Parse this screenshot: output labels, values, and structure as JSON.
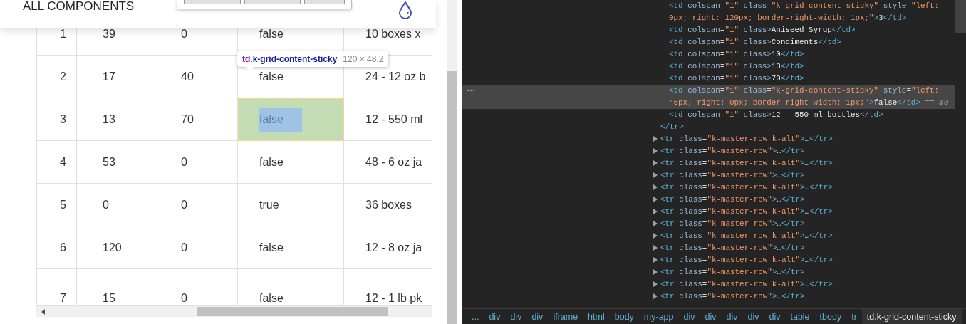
{
  "app_header": {
    "title": "ALL COMPONENTS"
  },
  "grid": {
    "rows": [
      {
        "cells": [
          "1",
          "39",
          "0",
          "false",
          "10 boxes x"
        ],
        "inspected": false
      },
      {
        "cells": [
          "2",
          "17",
          "40",
          "false",
          "24 - 12 oz b"
        ],
        "inspected": false
      },
      {
        "cells": [
          "3",
          "13",
          "70",
          "false",
          "12 - 550 ml"
        ],
        "inspected": true
      },
      {
        "cells": [
          "4",
          "53",
          "0",
          "false",
          "48 - 6 oz ja"
        ],
        "inspected": false
      },
      {
        "cells": [
          "5",
          "0",
          "0",
          "true",
          "36 boxes"
        ],
        "inspected": false
      },
      {
        "cells": [
          "6",
          "120",
          "0",
          "false",
          "12 - 8 oz ja"
        ],
        "inspected": false
      },
      {
        "cells": [
          "7",
          "15",
          "0",
          "false",
          "12 - 1 lb pk"
        ],
        "inspected": false
      }
    ]
  },
  "inspect_tooltip": {
    "tag": "td",
    "selector": ".k-grid-content-sticky",
    "size": "120 × 48.2"
  },
  "devtools": {
    "lines": [
      {
        "kind": "cell",
        "selected": false,
        "tokens": [
          {
            "kind": "tag",
            "text": "<td"
          },
          {
            "kind": "attr",
            "text": " colspan"
          },
          {
            "kind": "punct",
            "text": "="
          },
          {
            "kind": "value",
            "text": "\"1\""
          },
          {
            "kind": "attr",
            "text": " class"
          },
          {
            "kind": "punct",
            "text": "="
          },
          {
            "kind": "value",
            "text": "\"k-grid-content-sticky\""
          },
          {
            "kind": "attr",
            "text": " style"
          },
          {
            "kind": "punct",
            "text": "="
          },
          {
            "kind": "value",
            "text": "\"left: 0px; right: 120px; border-right-width: 1px;\""
          },
          {
            "kind": "tag",
            "text": ">"
          },
          {
            "kind": "text",
            "text": "3"
          },
          {
            "kind": "tag",
            "text": "</td>"
          }
        ]
      },
      {
        "kind": "cell",
        "selected": false,
        "tokens": [
          {
            "kind": "tag",
            "text": "<td"
          },
          {
            "kind": "attr",
            "text": " colspan"
          },
          {
            "kind": "punct",
            "text": "="
          },
          {
            "kind": "value",
            "text": "\"1\""
          },
          {
            "kind": "attr",
            "text": " class"
          },
          {
            "kind": "tag",
            "text": ">"
          },
          {
            "kind": "text",
            "text": "Aniseed Syrup"
          },
          {
            "kind": "tag",
            "text": "</td>"
          }
        ]
      },
      {
        "kind": "cell",
        "selected": false,
        "tokens": [
          {
            "kind": "tag",
            "text": "<td"
          },
          {
            "kind": "attr",
            "text": " colspan"
          },
          {
            "kind": "punct",
            "text": "="
          },
          {
            "kind": "value",
            "text": "\"1\""
          },
          {
            "kind": "attr",
            "text": " class"
          },
          {
            "kind": "tag",
            "text": ">"
          },
          {
            "kind": "text",
            "text": "Condiments"
          },
          {
            "kind": "tag",
            "text": "</td>"
          }
        ]
      },
      {
        "kind": "cell",
        "selected": false,
        "tokens": [
          {
            "kind": "tag",
            "text": "<td"
          },
          {
            "kind": "attr",
            "text": " colspan"
          },
          {
            "kind": "punct",
            "text": "="
          },
          {
            "kind": "value",
            "text": "\"1\""
          },
          {
            "kind": "attr",
            "text": " class"
          },
          {
            "kind": "tag",
            "text": ">"
          },
          {
            "kind": "text",
            "text": "10"
          },
          {
            "kind": "tag",
            "text": "</td>"
          }
        ]
      },
      {
        "kind": "cell",
        "selected": false,
        "tokens": [
          {
            "kind": "tag",
            "text": "<td"
          },
          {
            "kind": "attr",
            "text": " colspan"
          },
          {
            "kind": "punct",
            "text": "="
          },
          {
            "kind": "value",
            "text": "\"1\""
          },
          {
            "kind": "attr",
            "text": " class"
          },
          {
            "kind": "tag",
            "text": ">"
          },
          {
            "kind": "text",
            "text": "13"
          },
          {
            "kind": "tag",
            "text": "</td>"
          }
        ]
      },
      {
        "kind": "cell",
        "selected": false,
        "tokens": [
          {
            "kind": "tag",
            "text": "<td"
          },
          {
            "kind": "attr",
            "text": " colspan"
          },
          {
            "kind": "punct",
            "text": "="
          },
          {
            "kind": "value",
            "text": "\"1\""
          },
          {
            "kind": "attr",
            "text": " class"
          },
          {
            "kind": "tag",
            "text": ">"
          },
          {
            "kind": "text",
            "text": "70"
          },
          {
            "kind": "tag",
            "text": "</td>"
          }
        ]
      },
      {
        "kind": "cell",
        "selected": true,
        "tokens": [
          {
            "kind": "tag",
            "text": "<td"
          },
          {
            "kind": "attr",
            "text": " colspan"
          },
          {
            "kind": "punct",
            "text": "="
          },
          {
            "kind": "value",
            "text": "\"1\""
          },
          {
            "kind": "attr",
            "text": " class"
          },
          {
            "kind": "punct",
            "text": "="
          },
          {
            "kind": "value",
            "text": "\"k-grid-content-sticky\""
          },
          {
            "kind": "attr",
            "text": " style"
          },
          {
            "kind": "punct",
            "text": "="
          },
          {
            "kind": "value",
            "text": "\"left: 45px; right: 0px; border-right-width: 1px;\""
          },
          {
            "kind": "tag",
            "text": ">"
          },
          {
            "kind": "text",
            "text": "false"
          },
          {
            "kind": "tag",
            "text": "</td>"
          },
          {
            "kind": "ref",
            "text": " == $0"
          }
        ]
      },
      {
        "kind": "cell",
        "selected": false,
        "tokens": [
          {
            "kind": "tag",
            "text": "<td"
          },
          {
            "kind": "attr",
            "text": " colspan"
          },
          {
            "kind": "punct",
            "text": "="
          },
          {
            "kind": "value",
            "text": "\"1\""
          },
          {
            "kind": "attr",
            "text": " class"
          },
          {
            "kind": "tag",
            "text": ">"
          },
          {
            "kind": "text",
            "text": "12 - 550 ml bottles"
          },
          {
            "kind": "tag",
            "text": "</td>"
          }
        ]
      },
      {
        "kind": "row_end",
        "selected": false,
        "tokens": [
          {
            "kind": "tag",
            "text": "</tr>"
          }
        ]
      },
      {
        "kind": "row",
        "selected": false,
        "tokens": [
          {
            "kind": "tag",
            "text": "<tr"
          },
          {
            "kind": "attr",
            "text": " class"
          },
          {
            "kind": "punct",
            "text": "="
          },
          {
            "kind": "value",
            "text": "\"k-master-row k-alt\""
          },
          {
            "kind": "tag",
            "text": ">"
          },
          {
            "kind": "text",
            "text": "…"
          },
          {
            "kind": "tag",
            "text": "</tr>"
          }
        ]
      },
      {
        "kind": "row",
        "selected": false,
        "tokens": [
          {
            "kind": "tag",
            "text": "<tr"
          },
          {
            "kind": "attr",
            "text": " class"
          },
          {
            "kind": "punct",
            "text": "="
          },
          {
            "kind": "value",
            "text": "\"k-master-row\""
          },
          {
            "kind": "tag",
            "text": ">"
          },
          {
            "kind": "text",
            "text": "…"
          },
          {
            "kind": "tag",
            "text": "</tr>"
          }
        ]
      },
      {
        "kind": "row",
        "selected": false,
        "tokens": [
          {
            "kind": "tag",
            "text": "<tr"
          },
          {
            "kind": "attr",
            "text": " class"
          },
          {
            "kind": "punct",
            "text": "="
          },
          {
            "kind": "value",
            "text": "\"k-master-row k-alt\""
          },
          {
            "kind": "tag",
            "text": ">"
          },
          {
            "kind": "text",
            "text": "…"
          },
          {
            "kind": "tag",
            "text": "</tr>"
          }
        ]
      },
      {
        "kind": "row",
        "selected": false,
        "tokens": [
          {
            "kind": "tag",
            "text": "<tr"
          },
          {
            "kind": "attr",
            "text": " class"
          },
          {
            "kind": "punct",
            "text": "="
          },
          {
            "kind": "value",
            "text": "\"k-master-row\""
          },
          {
            "kind": "tag",
            "text": ">"
          },
          {
            "kind": "text",
            "text": "…"
          },
          {
            "kind": "tag",
            "text": "</tr>"
          }
        ]
      },
      {
        "kind": "row",
        "selected": false,
        "tokens": [
          {
            "kind": "tag",
            "text": "<tr"
          },
          {
            "kind": "attr",
            "text": " class"
          },
          {
            "kind": "punct",
            "text": "="
          },
          {
            "kind": "value",
            "text": "\"k-master-row k-alt\""
          },
          {
            "kind": "tag",
            "text": ">"
          },
          {
            "kind": "text",
            "text": "…"
          },
          {
            "kind": "tag",
            "text": "</tr>"
          }
        ]
      },
      {
        "kind": "row",
        "selected": false,
        "tokens": [
          {
            "kind": "tag",
            "text": "<tr"
          },
          {
            "kind": "attr",
            "text": " class"
          },
          {
            "kind": "punct",
            "text": "="
          },
          {
            "kind": "value",
            "text": "\"k-master-row\""
          },
          {
            "kind": "tag",
            "text": ">"
          },
          {
            "kind": "text",
            "text": "…"
          },
          {
            "kind": "tag",
            "text": "</tr>"
          }
        ]
      },
      {
        "kind": "row",
        "selected": false,
        "tokens": [
          {
            "kind": "tag",
            "text": "<tr"
          },
          {
            "kind": "attr",
            "text": " class"
          },
          {
            "kind": "punct",
            "text": "="
          },
          {
            "kind": "value",
            "text": "\"k-master-row k-alt\""
          },
          {
            "kind": "tag",
            "text": ">"
          },
          {
            "kind": "text",
            "text": "…"
          },
          {
            "kind": "tag",
            "text": "</tr>"
          }
        ]
      },
      {
        "kind": "row",
        "selected": false,
        "tokens": [
          {
            "kind": "tag",
            "text": "<tr"
          },
          {
            "kind": "attr",
            "text": " class"
          },
          {
            "kind": "punct",
            "text": "="
          },
          {
            "kind": "value",
            "text": "\"k-master-row\""
          },
          {
            "kind": "tag",
            "text": ">"
          },
          {
            "kind": "text",
            "text": "…"
          },
          {
            "kind": "tag",
            "text": "</tr>"
          }
        ]
      },
      {
        "kind": "row",
        "selected": false,
        "tokens": [
          {
            "kind": "tag",
            "text": "<tr"
          },
          {
            "kind": "attr",
            "text": " class"
          },
          {
            "kind": "punct",
            "text": "="
          },
          {
            "kind": "value",
            "text": "\"k-master-row k-alt\""
          },
          {
            "kind": "tag",
            "text": ">"
          },
          {
            "kind": "text",
            "text": "…"
          },
          {
            "kind": "tag",
            "text": "</tr>"
          }
        ]
      },
      {
        "kind": "row",
        "selected": false,
        "tokens": [
          {
            "kind": "tag",
            "text": "<tr"
          },
          {
            "kind": "attr",
            "text": " class"
          },
          {
            "kind": "punct",
            "text": "="
          },
          {
            "kind": "value",
            "text": "\"k-master-row\""
          },
          {
            "kind": "tag",
            "text": ">"
          },
          {
            "kind": "text",
            "text": "…"
          },
          {
            "kind": "tag",
            "text": "</tr>"
          }
        ]
      },
      {
        "kind": "row",
        "selected": false,
        "tokens": [
          {
            "kind": "tag",
            "text": "<tr"
          },
          {
            "kind": "attr",
            "text": " class"
          },
          {
            "kind": "punct",
            "text": "="
          },
          {
            "kind": "value",
            "text": "\"k-master-row k-alt\""
          },
          {
            "kind": "tag",
            "text": ">"
          },
          {
            "kind": "text",
            "text": "…"
          },
          {
            "kind": "tag",
            "text": "</tr>"
          }
        ]
      },
      {
        "kind": "row",
        "selected": false,
        "tokens": [
          {
            "kind": "tag",
            "text": "<tr"
          },
          {
            "kind": "attr",
            "text": " class"
          },
          {
            "kind": "punct",
            "text": "="
          },
          {
            "kind": "value",
            "text": "\"k-master-row\""
          },
          {
            "kind": "tag",
            "text": ">"
          },
          {
            "kind": "text",
            "text": "…"
          },
          {
            "kind": "tag",
            "text": "</tr>"
          }
        ]
      },
      {
        "kind": "row",
        "selected": false,
        "tokens": [
          {
            "kind": "tag",
            "text": "<tr"
          },
          {
            "kind": "attr",
            "text": " class"
          },
          {
            "kind": "punct",
            "text": "="
          },
          {
            "kind": "value",
            "text": "\"k-master-row k-alt\""
          },
          {
            "kind": "tag",
            "text": ">"
          },
          {
            "kind": "text",
            "text": "…"
          },
          {
            "kind": "tag",
            "text": "</tr>"
          }
        ]
      },
      {
        "kind": "row",
        "selected": false,
        "tokens": [
          {
            "kind": "tag",
            "text": "<tr"
          },
          {
            "kind": "attr",
            "text": " class"
          },
          {
            "kind": "punct",
            "text": "="
          },
          {
            "kind": "value",
            "text": "\"k-master-row\""
          },
          {
            "kind": "tag",
            "text": ">"
          },
          {
            "kind": "text",
            "text": "…"
          },
          {
            "kind": "tag",
            "text": "</tr>"
          }
        ]
      }
    ],
    "breadcrumbs": [
      {
        "label": "...",
        "selected": false
      },
      {
        "label": "div",
        "selected": false
      },
      {
        "label": "div",
        "selected": false
      },
      {
        "label": "div",
        "selected": false
      },
      {
        "label": "iframe",
        "selected": false
      },
      {
        "label": "html",
        "selected": false
      },
      {
        "label": "body",
        "selected": false
      },
      {
        "label": "my-app",
        "selected": false
      },
      {
        "label": "div",
        "selected": false
      },
      {
        "label": "div",
        "selected": false
      },
      {
        "label": "div",
        "selected": false
      },
      {
        "label": "div",
        "selected": false
      },
      {
        "label": "div",
        "selected": false
      },
      {
        "label": "table",
        "selected": false
      },
      {
        "label": "tbody",
        "selected": false
      },
      {
        "label": "tr",
        "selected": false
      },
      {
        "label": "td.k-grid-content-sticky",
        "selected": true
      }
    ]
  }
}
